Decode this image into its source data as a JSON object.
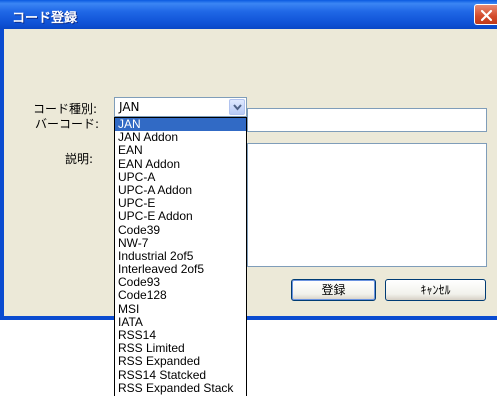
{
  "window": {
    "title": "コード登録"
  },
  "form": {
    "code_type_label": "コード種別:",
    "code_type_value": "JAN",
    "barcode_label": "バーコード:",
    "description_label": "説明:"
  },
  "buttons": {
    "register": "登録",
    "cancel": "ｷｬﾝｾﾙ"
  },
  "dropdown": {
    "selected_index": 0,
    "options": [
      "JAN",
      "JAN Addon",
      "EAN",
      "EAN Addon",
      "UPC-A",
      "UPC-A Addon",
      "UPC-E",
      "UPC-E Addon",
      "Code39",
      "NW-7",
      "Industrial 2of5",
      "Interleaved 2of5",
      "Code93",
      "Code128",
      "MSI",
      "IATA",
      "RSS14",
      "RSS Limited",
      "RSS Expanded",
      "RSS14 Statcked",
      "RSS Expanded Stack"
    ]
  },
  "colors": {
    "title_bar": "#0a5ae0",
    "selection": "#316ac5",
    "dialog_bg": "#ece9d8",
    "close_button": "#d24a2a"
  },
  "icons": {
    "close": "close-icon",
    "combo_arrow": "chevron-down-icon"
  }
}
